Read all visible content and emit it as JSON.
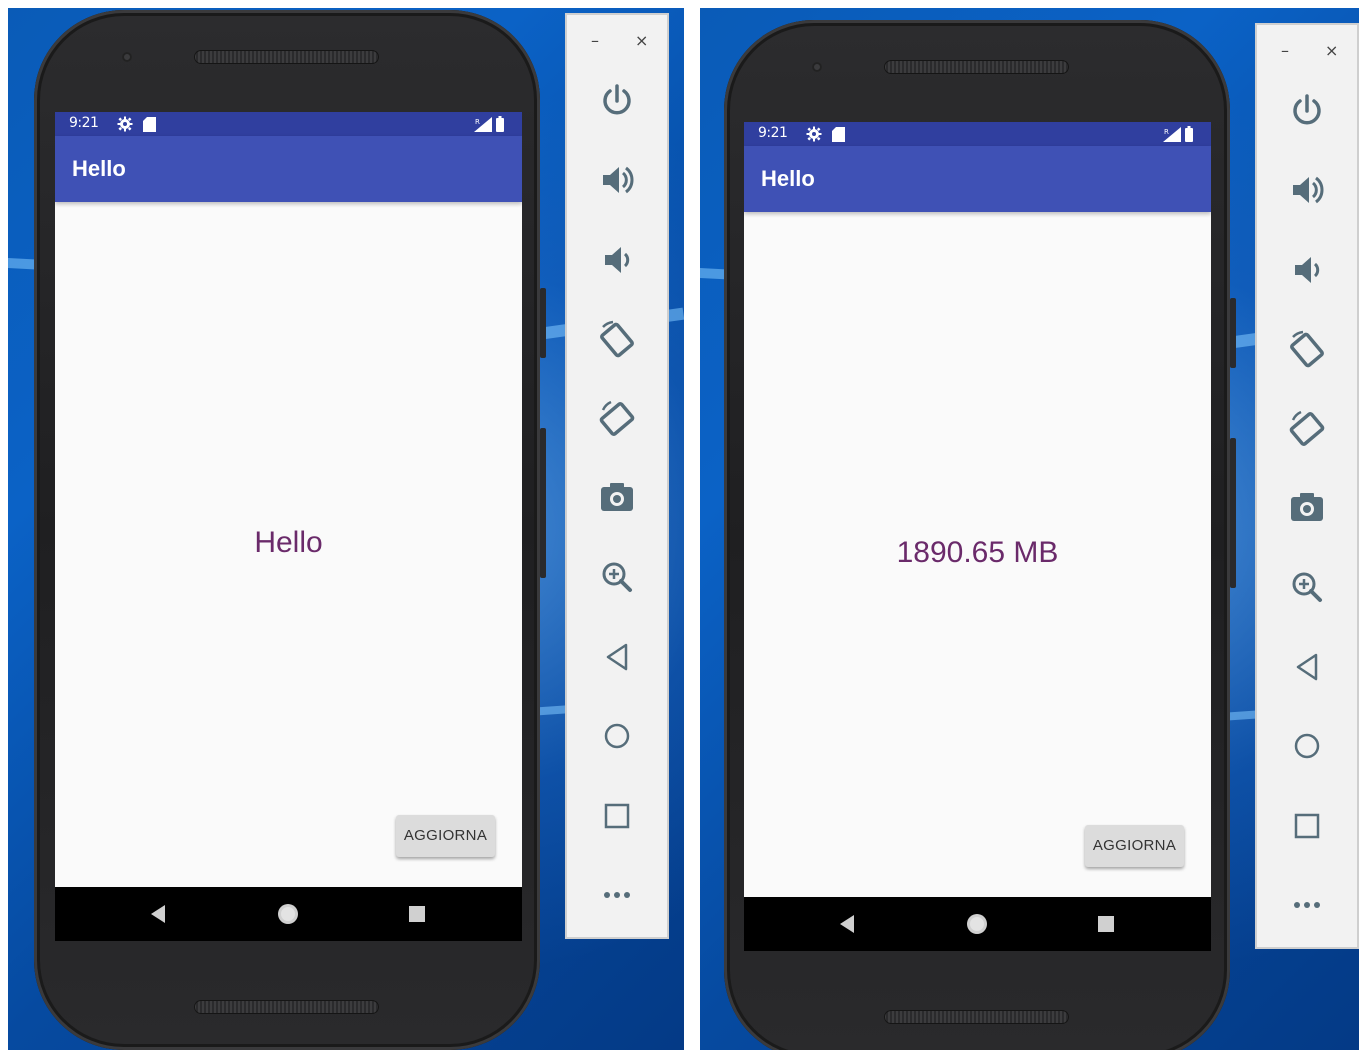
{
  "left_emulator": {
    "status_time": "9:21",
    "app_title": "Hello",
    "content_text": "Hello",
    "button_label": "AGGIORNA"
  },
  "right_emulator": {
    "status_time": "9:21",
    "app_title": "Hello",
    "content_text": "1890.65 MB",
    "button_label": "AGGIORNA"
  },
  "toolbar": {
    "minimize_label": "–",
    "close_label": "×",
    "icons": [
      "power-icon",
      "volume-up-icon",
      "volume-down-icon",
      "rotate-left-icon",
      "rotate-right-icon",
      "camera-icon",
      "zoom-icon",
      "back-icon",
      "home-icon",
      "overview-icon",
      "more-icon"
    ]
  },
  "colors": {
    "primary": "#3f51b5",
    "primary_dark": "#303f9f",
    "content_text": "#6a2a6a",
    "button_bg": "#dcdcdc",
    "screen_bg": "#fafafa",
    "toolbar_bg": "#f2f2f2"
  }
}
